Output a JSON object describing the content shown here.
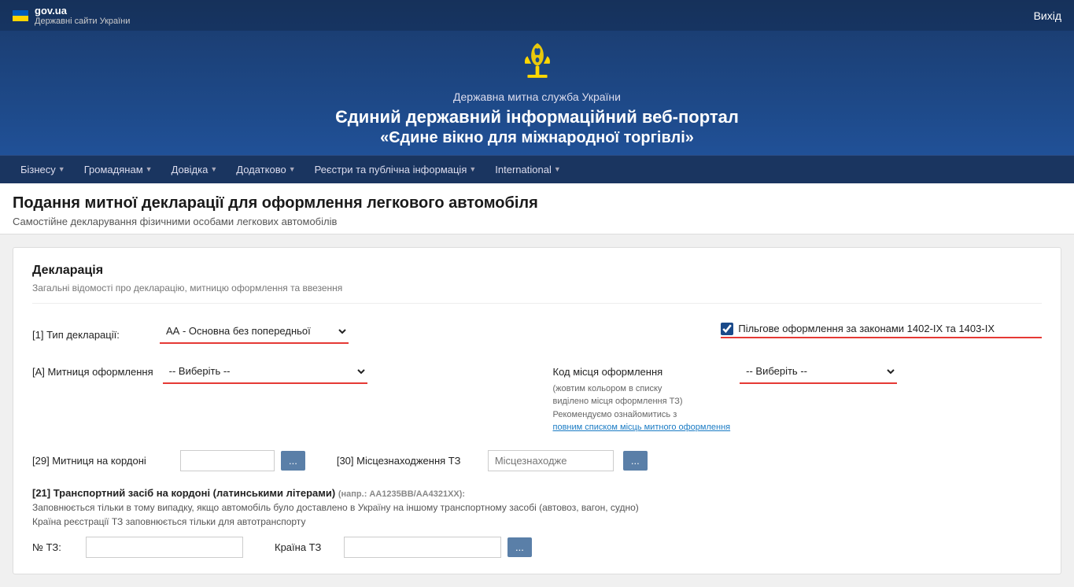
{
  "header": {
    "gov_ua": "gov.ua",
    "gov_ua_sub": "Державні сайти України",
    "agency": "Державна митна служба України",
    "title_main": "Єдиний державний інформаційний веб-портал",
    "title_sub": "«Єдине вікно для міжнародної торгівлі»",
    "logout": "Вихід"
  },
  "nav": {
    "items": [
      {
        "label": "Бізнесу",
        "has_arrow": true
      },
      {
        "label": "Громадянам",
        "has_arrow": true
      },
      {
        "label": "Довідка",
        "has_arrow": true
      },
      {
        "label": "Додатково",
        "has_arrow": true
      },
      {
        "label": "Реєстри та публічна інформація",
        "has_arrow": true
      },
      {
        "label": "International",
        "has_arrow": true
      }
    ]
  },
  "page": {
    "title": "Подання митної декларації для оформлення легкового автомобіля",
    "subtitle": "Самостійне декларування фізичними особами легкових автомобілів"
  },
  "declaration": {
    "section_title": "Декларація",
    "section_desc": "Загальні відомості про декларацію, митницю оформлення та ввезення",
    "field_type_label": "[1] Тип декларації:",
    "field_type_value": "АА - Основна без попередньої",
    "field_type_placeholder": "АА - Основна без попередньої",
    "checkbox_label": "Пільгове оформлення за законами 1402-IX та 1403-IX",
    "field_customs_label": "[А] Митниця оформлення",
    "field_customs_placeholder": "-- Виберіть --",
    "field_code_label": "Код місця оформлення",
    "field_code_placeholder": "-- Виберіть --",
    "field_code_desc1": "(жовтим кольором в списку",
    "field_code_desc2": "виділено місця оформлення ТЗ)",
    "field_code_desc3": "Рекомендуємо ознайомитись з",
    "field_code_link": "повним списком місць митного оформлення",
    "field_border_label": "[29] Митниця на кордоні",
    "field_border_dots": "...",
    "field_location_label": "[30] Місцезнаходження ТЗ",
    "field_location_placeholder": "Місцезнаходже",
    "field_location_dots": "...",
    "transport_title": "[21] Транспортний засіб на кордоні (латинськими літерами)",
    "transport_hint": "(напр.: AA1235BB/AA4321XX):",
    "transport_sub1": "Заповнюється тільки в тому випадку, якщо автомобіль було доставлено в Україну на іншому транспортному засобі (автовоз, вагон, судно)",
    "transport_sub2": "Країна реєстрації ТЗ заповнюється тільки для автотранспорту",
    "transport_no_label": "№ ТЗ:",
    "transport_country_label": "Країна ТЗ"
  }
}
